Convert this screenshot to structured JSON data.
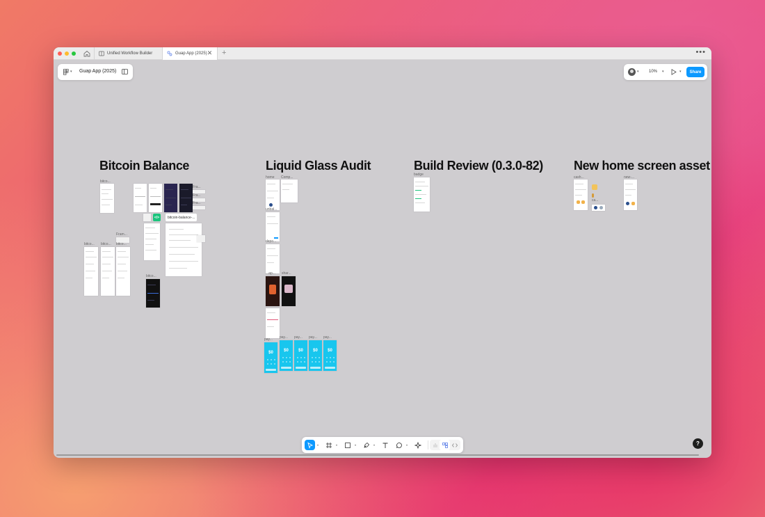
{
  "window": {
    "tabs": [
      {
        "label": "Unified Workflow Builder",
        "icon": "board-icon"
      },
      {
        "label": "Guap App (2025)",
        "icon": "design-file-icon",
        "active": true
      }
    ],
    "new_tab_label": "+",
    "close_glyph": "✕",
    "more_glyph": "•••"
  },
  "file_menu": {
    "file_name": "Guap App (2025)"
  },
  "header_right": {
    "zoom": "10%",
    "share_label": "Share"
  },
  "sections": [
    {
      "title": "Bitcoin Balance"
    },
    {
      "title": "Liquid Glass Audit"
    },
    {
      "title": "Build Review (0.3.0-82)"
    },
    {
      "title": "New home screen asset"
    }
  ],
  "frame_labels": {
    "bitcoin_top": "bitco...",
    "fra_1": "Fra...",
    "fra_2": "Fra...",
    "fra_3": "Fra...",
    "frame_mid": "Fram...",
    "bitcoin_a": "bitco...",
    "bitcoin_b": "bitco...",
    "bitcoin_c": "bitco...",
    "bitcoin_dark": "bitco...",
    "bitcoin_balance_chip": "bitcoin-balance-...",
    "code_chip": "</>",
    "home": "home",
    "comp": "Comp...",
    "unbal": "unbal...",
    "depo": "depo...",
    "ru_ap": "...ap...",
    "shar": "shar...",
    "pay_1": "pay...",
    "pay_2": "pay...",
    "pay_3": "pay...",
    "pay_4": "pay...",
    "pay_5": "pay...",
    "badge": "badge",
    "cash": "cash...",
    "ca": "ca...",
    "new": "new-..."
  },
  "pay_frames": {
    "amount": "$0"
  },
  "help": {
    "label": "?"
  },
  "colors": {
    "accent": "#0d99ff",
    "canvas": "#cfcdd0",
    "code_green": "#1bc47d",
    "cyan_frame": "#18c6ee"
  }
}
